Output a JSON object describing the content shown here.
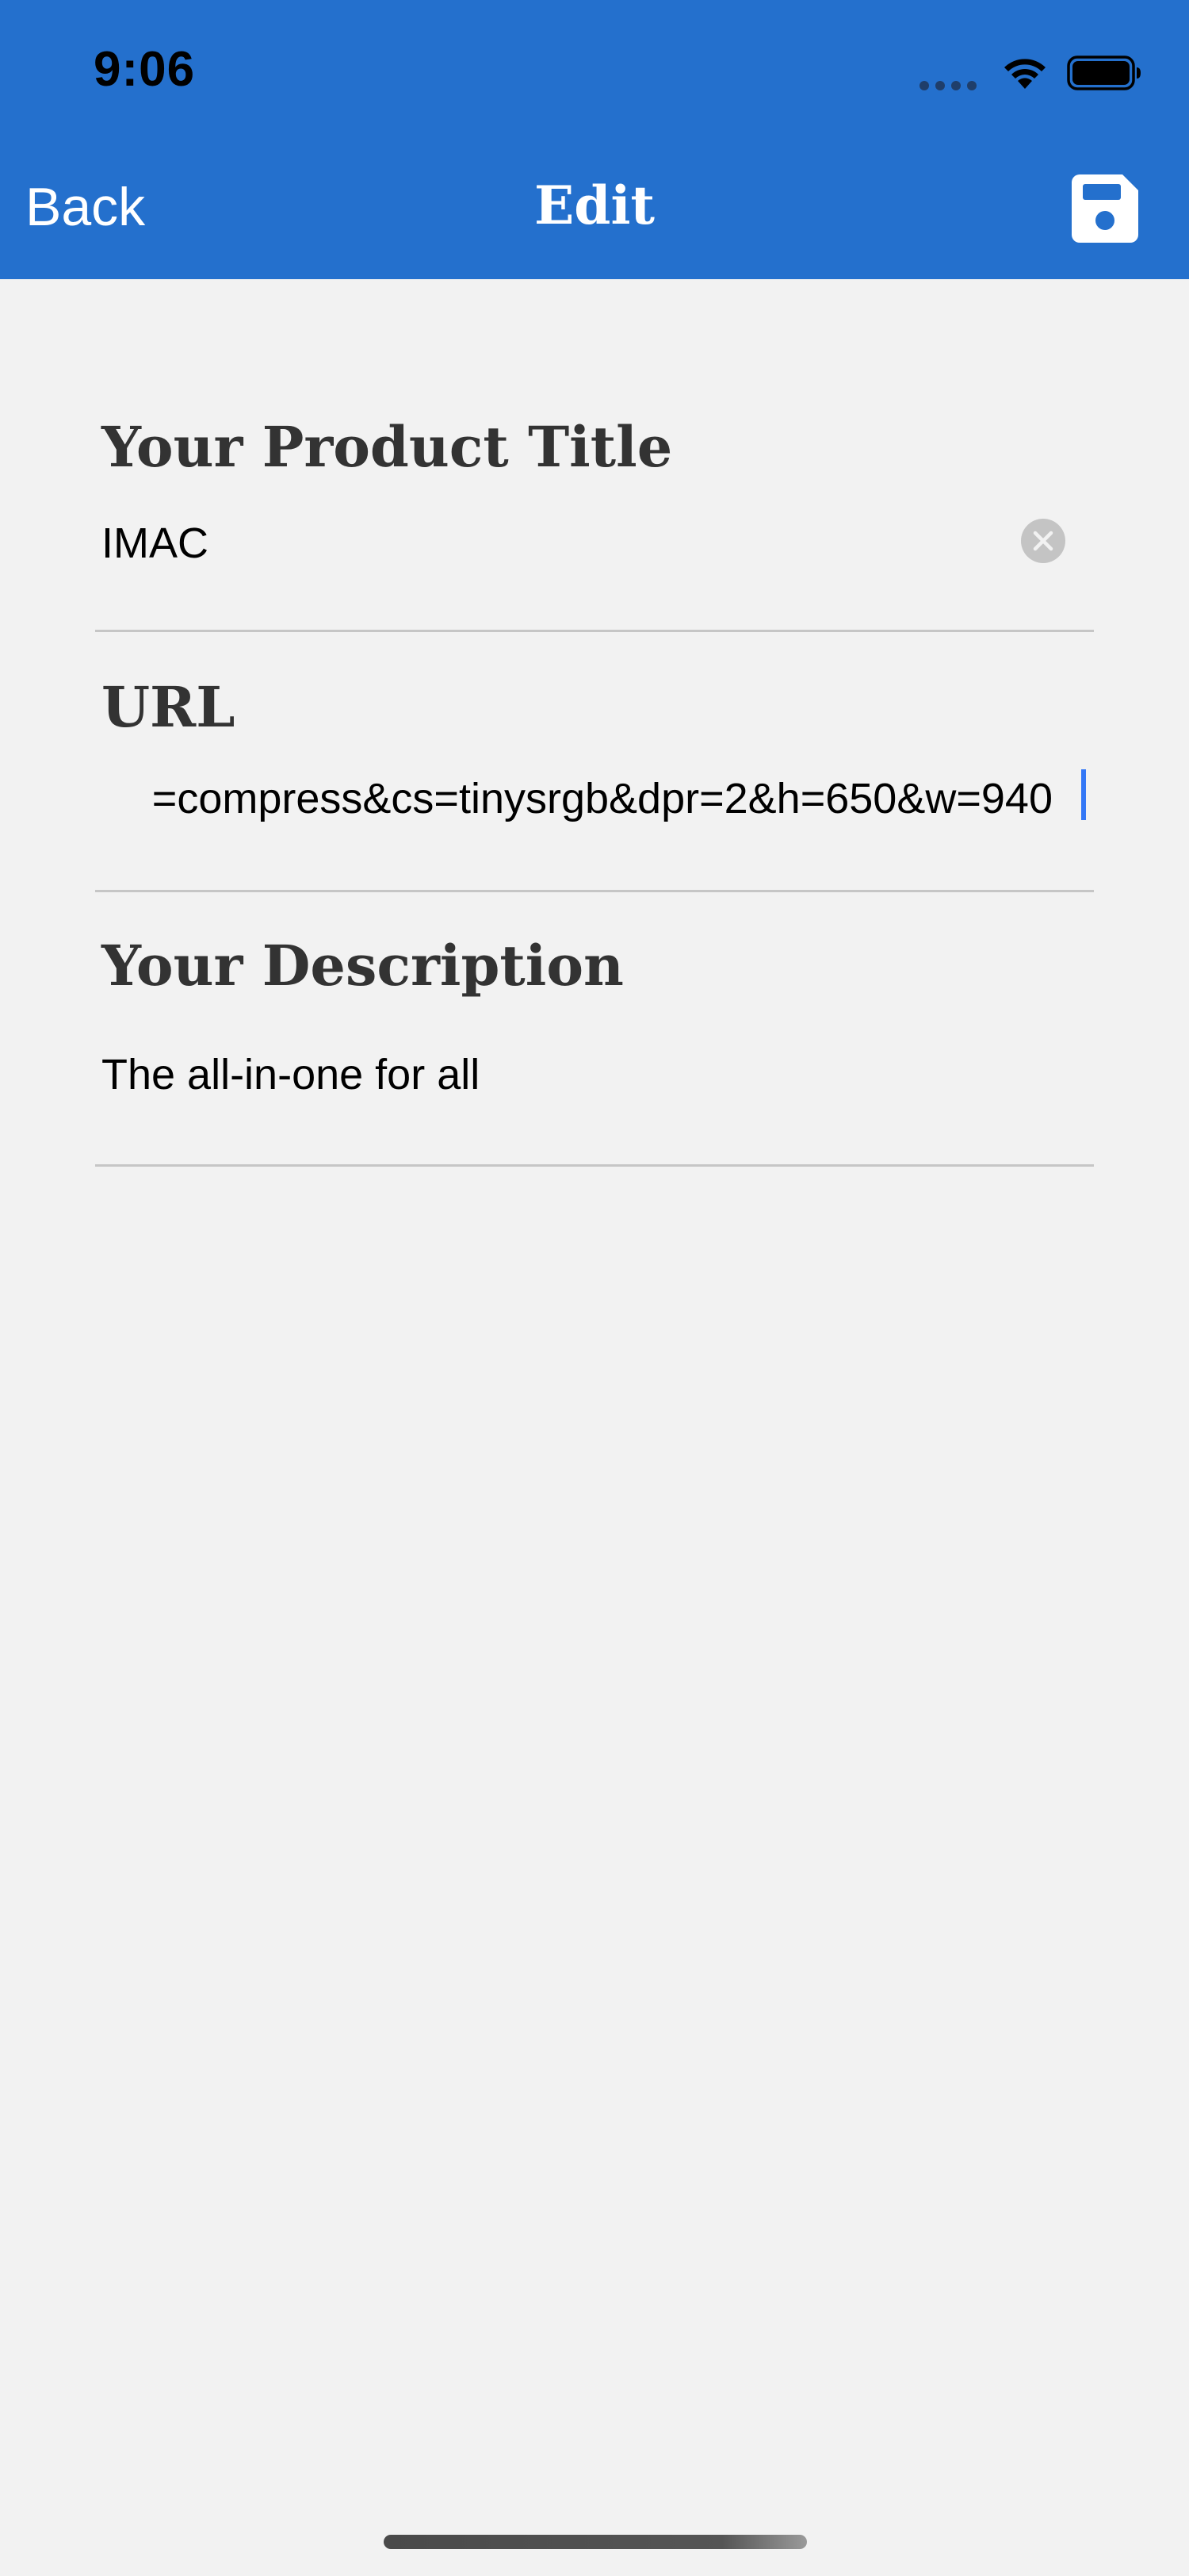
{
  "status_bar": {
    "time": "9:06"
  },
  "nav": {
    "back_label": "Back",
    "title": "Edit",
    "save_icon": "save-icon"
  },
  "form": {
    "title_field": {
      "label": "Your Product Title",
      "value": "IMAC",
      "clear_icon": "clear-icon"
    },
    "url_field": {
      "label": "URL",
      "value": "=compress&cs=tinysrgb&dpr=2&h=650&w=940"
    },
    "description_field": {
      "label": "Your Description",
      "value": "The all-in-one for all"
    }
  },
  "colors": {
    "header": "#2470cd",
    "background": "#f2f2f2",
    "label_text": "#333333",
    "divider": "#c6c6c6",
    "caret": "#3478f6"
  }
}
